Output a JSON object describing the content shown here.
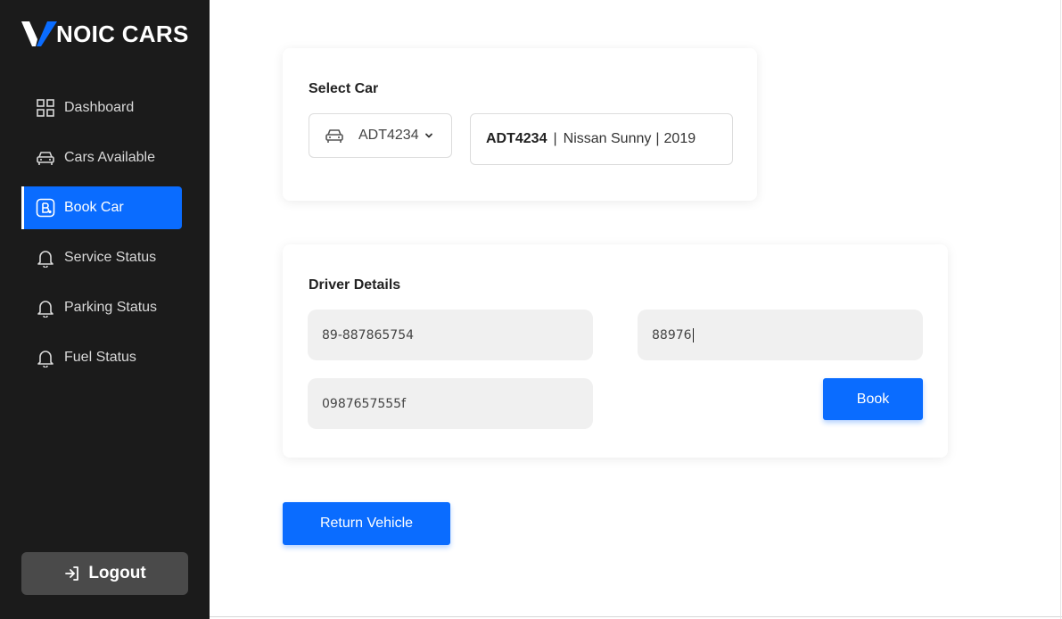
{
  "brand": {
    "logo_letter": "V",
    "name": "NOIC CARS",
    "accent": "#0a6cff"
  },
  "sidebar": {
    "items": [
      {
        "label": "Dashboard",
        "icon": "dashboard-grid-icon",
        "active": false
      },
      {
        "label": "Cars Available",
        "icon": "car-icon",
        "active": false
      },
      {
        "label": "Book Car",
        "icon": "book-b-icon",
        "active": true
      },
      {
        "label": "Service Status",
        "icon": "bell-icon",
        "active": false
      },
      {
        "label": "Parking Status",
        "icon": "bell-icon",
        "active": false
      },
      {
        "label": "Fuel Status",
        "icon": "bell-icon",
        "active": false
      }
    ],
    "logout_label": "Logout"
  },
  "select_car": {
    "title": "Select Car",
    "selected": "ADT4234",
    "details": {
      "plate": "ADT4234",
      "model": "Nissan Sunny",
      "year": "2019"
    }
  },
  "driver_details": {
    "title": "Driver Details",
    "field_1": "89-887865754",
    "field_2": "88976",
    "field_3": "0987657555f",
    "book_label": "Book"
  },
  "return_label": "Return Vehicle"
}
